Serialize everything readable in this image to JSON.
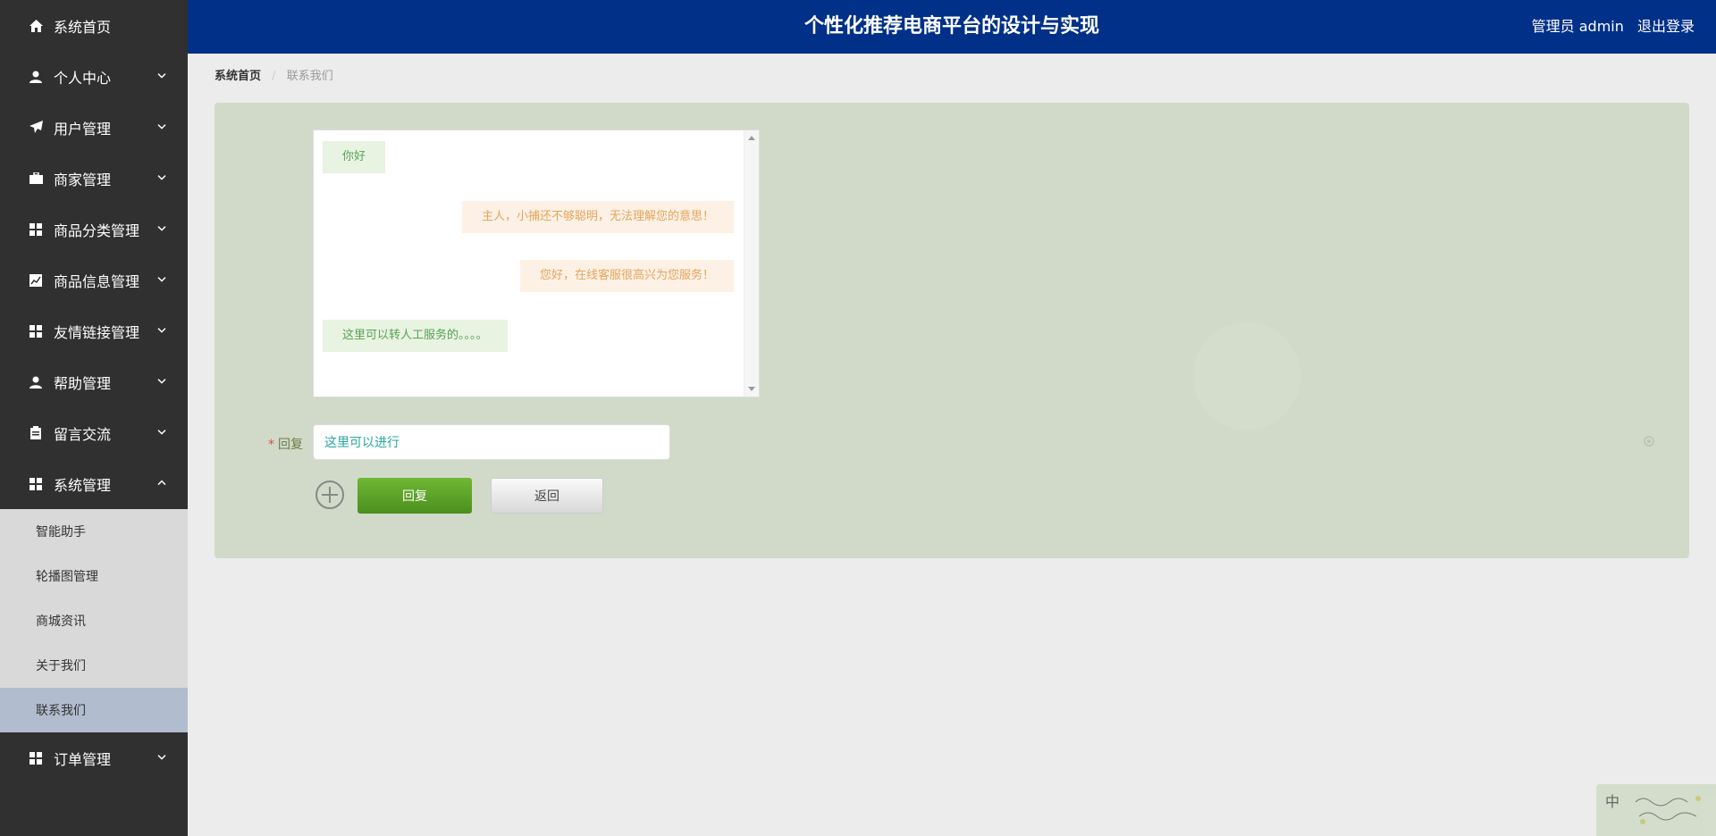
{
  "header": {
    "title": "个性化推荐电商平台的设计与实现",
    "user_role": "管理员 admin",
    "logout": "退出登录"
  },
  "sidebar": {
    "items": [
      {
        "label": "系统首页",
        "icon": "home-icon"
      },
      {
        "label": "个人中心",
        "icon": "user-icon"
      },
      {
        "label": "用户管理",
        "icon": "paper-plane-icon"
      },
      {
        "label": "商家管理",
        "icon": "briefcase-icon"
      },
      {
        "label": "商品分类管理",
        "icon": "grid-icon"
      },
      {
        "label": "商品信息管理",
        "icon": "chart-icon"
      },
      {
        "label": "友情链接管理",
        "icon": "grid-icon"
      },
      {
        "label": "帮助管理",
        "icon": "user-icon"
      },
      {
        "label": "留言交流",
        "icon": "clipboard-icon"
      },
      {
        "label": "系统管理",
        "icon": "grid-icon"
      },
      {
        "label": "订单管理",
        "icon": "grid-icon"
      }
    ],
    "sub_items": [
      "智能助手",
      "轮播图管理",
      "商城资讯",
      "关于我们",
      "联系我们"
    ]
  },
  "breadcrumb": {
    "home": "系统首页",
    "separator": "/",
    "current": "联系我们"
  },
  "chat": {
    "messages": [
      {
        "side": "left",
        "text": "你好"
      },
      {
        "side": "right",
        "text": "主人，小捕还不够聪明，无法理解您的意思！"
      },
      {
        "side": "right",
        "text": "您好，在线客服很高兴为您服务！"
      },
      {
        "side": "left",
        "text": "这里可以转人工服务的。。。。"
      }
    ]
  },
  "form": {
    "required_mark": "*",
    "reply_label": "回复",
    "reply_value": "这里可以进行",
    "reply_button": "回复",
    "back_button": "返回"
  },
  "ime": {
    "mode": "中"
  },
  "colors": {
    "header": "#003087",
    "sidebar": "#303030",
    "panel": "#d1dac9",
    "reply_button": "#5aa128"
  }
}
